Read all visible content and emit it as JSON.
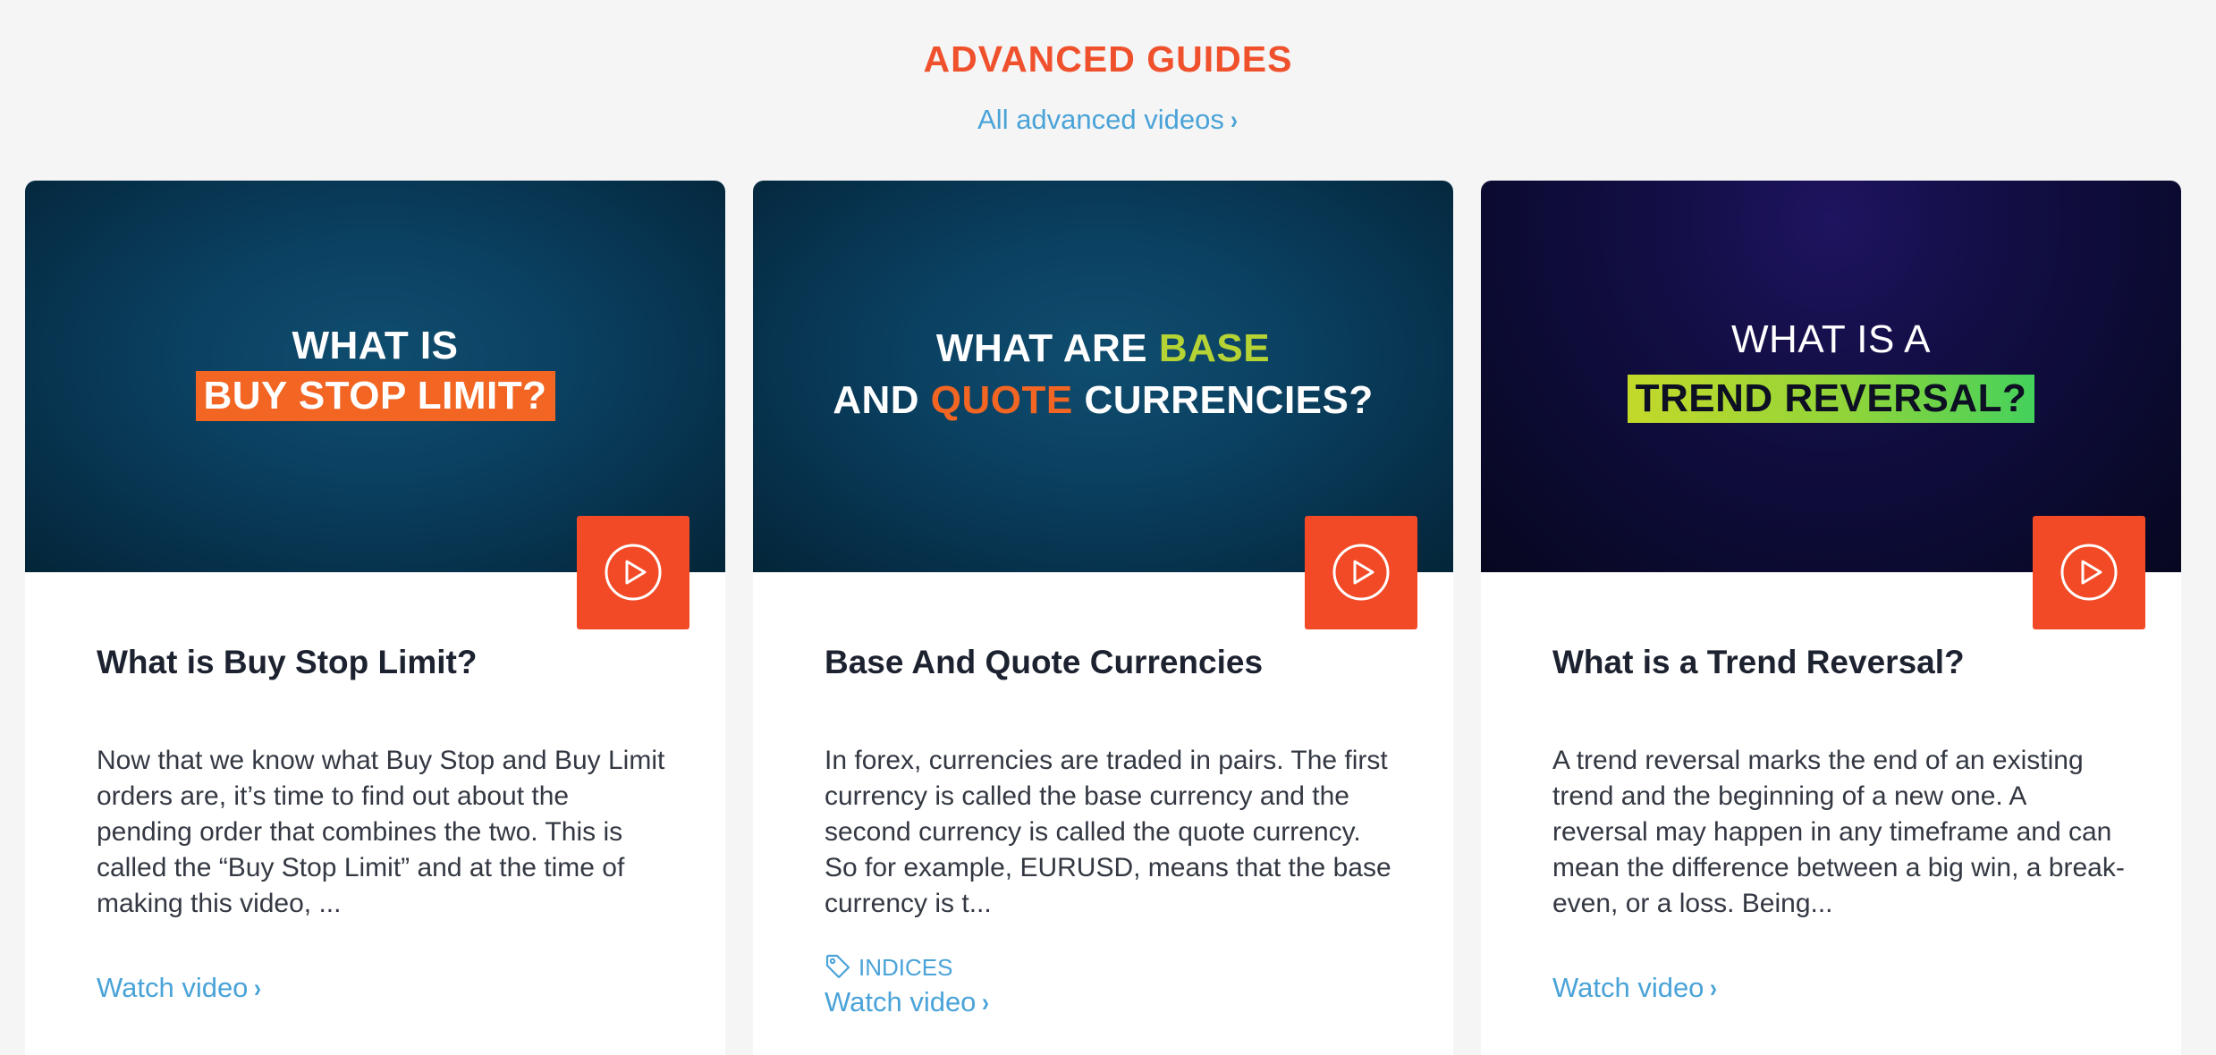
{
  "section": {
    "title": "ADVANCED GUIDES",
    "all_link": "All advanced videos",
    "link_color": "#4aa3d8",
    "title_color": "#f0512d"
  },
  "cards": [
    {
      "thumb": {
        "line1": "WHAT IS",
        "line2": "BUY STOP LIMIT?"
      },
      "title": "What is Buy Stop Limit?",
      "description": "Now that we know what Buy Stop and Buy Limit orders are, it’s time to find out about the pending order that combines the two. This is called the “Buy Stop Limit” and at the time of making this video, ...",
      "watch_label": "Watch video"
    },
    {
      "thumb": {
        "line1_a": "WHAT ARE ",
        "line1_b": "BASE",
        "line2_a": "AND ",
        "line2_b": "QUOTE",
        "line2_c": " CURRENCIES?"
      },
      "title": "Base And Quote Currencies",
      "description": "In forex, currencies are traded in pairs. The first currency is called the base currency and the second currency is called the quote currency. So for example, EURUSD, means that the base currency is t...",
      "tag": "INDICES",
      "watch_label": "Watch video"
    },
    {
      "thumb": {
        "line1": "WHAT IS A",
        "line2": "TREND REVERSAL?"
      },
      "title": "What is a Trend Reversal?",
      "description": "A trend reversal marks the end of an existing trend and the beginning of a new one. A reversal may happen in any timeframe and can mean the difference between a big win, a break-even, or a loss. Being...",
      "watch_label": "Watch video"
    }
  ],
  "icons": {
    "play": "play-circle-icon",
    "chevron": "chevron-right-icon",
    "tag": "tag-icon"
  },
  "colors": {
    "play_button": "#f24a26",
    "highlight_orange": "#f26522",
    "highlight_green": "#b5d334"
  }
}
